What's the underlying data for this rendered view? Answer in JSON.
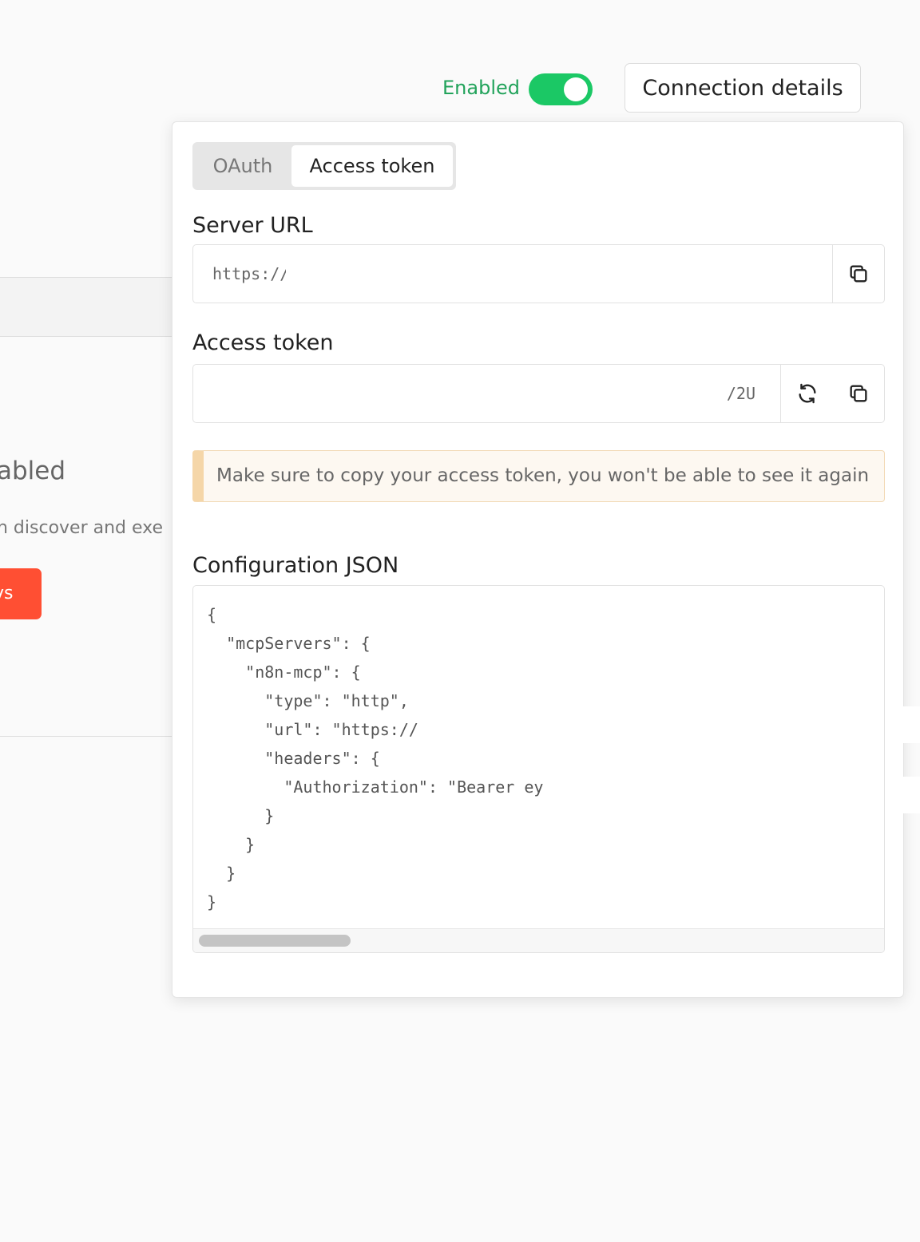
{
  "background": {
    "title_fragment": "abled",
    "description_fragment": "n discover and exe",
    "cta_fragment": "vs"
  },
  "header": {
    "enabled_label": "Enabled",
    "toggle_on": true,
    "connection_button_label": "Connection details"
  },
  "panel": {
    "tabs": [
      {
        "label": "OAuth",
        "active": false
      },
      {
        "label": "Access token",
        "active": true
      }
    ],
    "server_url": {
      "label": "Server URL",
      "value": "https://"
    },
    "access_token": {
      "label": "Access token",
      "value": "/2U"
    },
    "warning": "Make sure to copy your access token, you won't be able to see it again",
    "config": {
      "label": "Configuration JSON",
      "lines": [
        "{",
        "  \"mcpServers\": {",
        "    \"n8n-mcp\": {",
        "      \"type\": \"http\",",
        "      \"url\": \"https://",
        "      \"headers\": {",
        "        \"Authorization\": \"Bearer ey",
        "      }",
        "    }",
        "  }",
        "}"
      ]
    }
  },
  "colors": {
    "accent_green": "#1bc865",
    "enabled_text": "#22a35b",
    "cta_orange": "#ff4f33",
    "warning_border": "#f5d6a8"
  },
  "icons": [
    "copy-icon",
    "refresh-icon"
  ]
}
